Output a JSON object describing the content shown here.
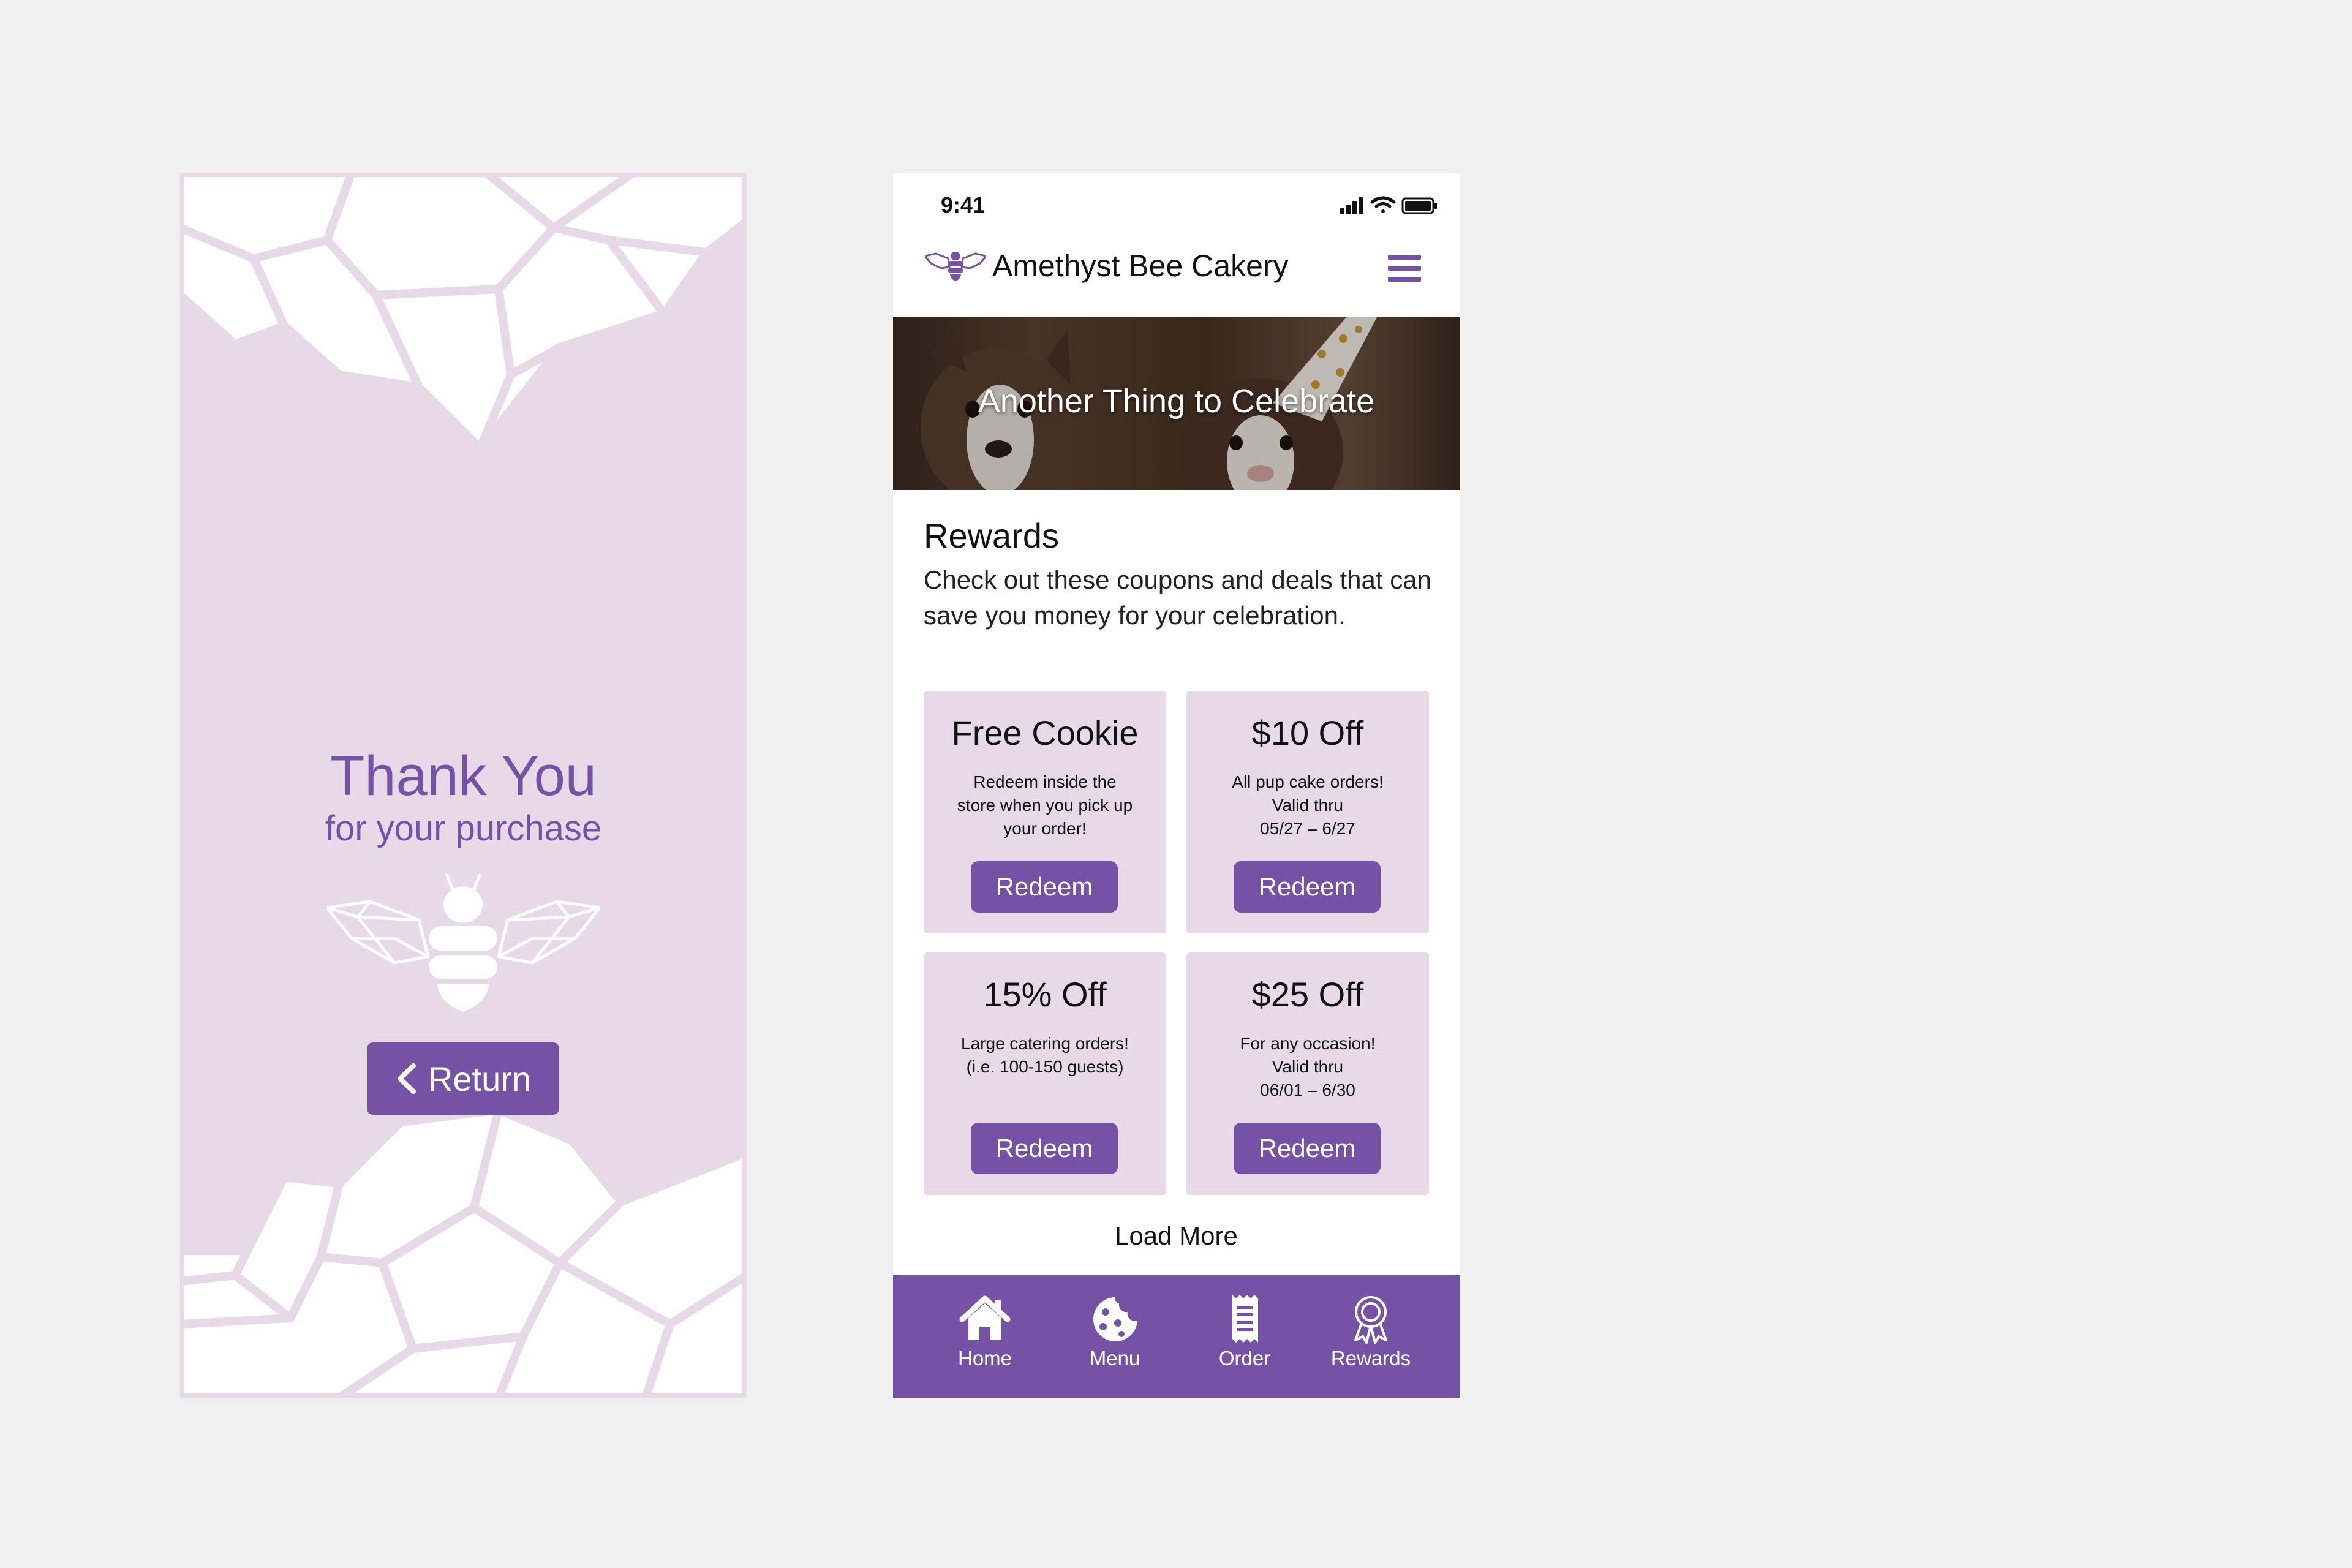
{
  "thanks_screen": {
    "title": "Thank You",
    "subtitle": "for your purchase",
    "return_label": "Return",
    "return_icon": "chevron-left-icon",
    "bee_icon": "bee-icon"
  },
  "phone": {
    "status_bar": {
      "time": "9:41"
    },
    "header": {
      "brand": "Amethyst Bee Cakery",
      "menu_icon": "hamburger-menu-icon"
    },
    "hero": {
      "title": "Another Thing to Celebrate"
    },
    "rewards": {
      "heading": "Rewards",
      "description": "Check out these coupons and deals that can save you money for your celebration."
    },
    "coupons": [
      {
        "title": "Free Cookie",
        "description": "Redeem inside the\nstore when you pick up\nyour order!",
        "button": "Redeem"
      },
      {
        "title": "$10 Off",
        "description": "All pup cake orders!\nValid thru\n05/27 – 6/27",
        "button": "Redeem"
      },
      {
        "title": "15% Off",
        "description": "Large catering orders!\n(i.e. 100-150 guests)",
        "button": "Redeem"
      },
      {
        "title": "$25 Off",
        "description": "For any occasion!\nValid thru\n06/01 – 6/30",
        "button": "Redeem"
      }
    ],
    "load_more": "Load More",
    "tabs": [
      {
        "label": "Home",
        "icon": "home-icon"
      },
      {
        "label": "Menu",
        "icon": "cookie-icon"
      },
      {
        "label": "Order",
        "icon": "receipt-icon"
      },
      {
        "label": "Rewards",
        "icon": "award-ribbon-icon"
      }
    ]
  },
  "colors": {
    "brand_purple": "#7552a6",
    "lavender_bg": "#e8d9e9",
    "page_bg": "#f0f0f0"
  }
}
